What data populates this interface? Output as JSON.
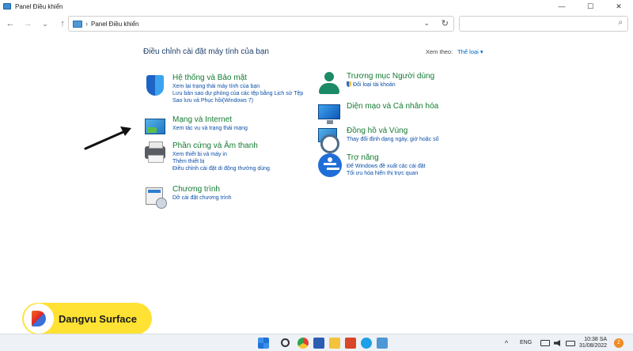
{
  "window": {
    "title": "Panel Điều khiển",
    "minimize": "—",
    "maximize": "☐",
    "close": "✕"
  },
  "nav": {
    "back": "←",
    "forward": "→",
    "dropdown": "⌄",
    "up": "↑",
    "breadcrumb_sep": "›",
    "path": "Panel Điều khiển",
    "address_dropdown": "⌄",
    "refresh": "↻",
    "search_placeholder": "",
    "search_icon": "⌕"
  },
  "header": {
    "title": "Điều chỉnh cài đặt máy tính của bạn",
    "view_by_label": "Xem theo:",
    "view_by_value": "Thể loại ▾"
  },
  "categories": [
    {
      "icon": "shield-icon",
      "title": "Hệ thống và Bảo mật",
      "links": [
        "Xem lại trạng thái máy tính của bạn",
        "Lưu bản sao dự phòng của các tệp bằng Lịch sử Tệp",
        "Sao lưu và Phục hồi(Windows 7)"
      ]
    },
    {
      "icon": "network-icon",
      "title": "Mạng và Internet",
      "links": [
        "Xem tác vụ và trạng thái mạng"
      ]
    },
    {
      "icon": "printer-icon",
      "title": "Phần cứng và Âm thanh",
      "links": [
        "Xem thiết bị và máy in",
        "Thêm thiết bị",
        "Điều chỉnh cài đặt di động thường dùng"
      ]
    },
    {
      "icon": "programs-icon",
      "title": "Chương trình",
      "links": [
        "Dỡ cài đặt chương trình"
      ]
    },
    {
      "icon": "user-accounts-icon",
      "title": "Trương mục Người dùng",
      "links": [
        "Đổi loại tài khoản"
      ]
    },
    {
      "icon": "appearance-icon",
      "title": "Diện mạo và Cá nhân hóa",
      "links": []
    },
    {
      "icon": "clock-region-icon",
      "title": "Đồng hồ và Vùng",
      "links": [
        "Thay đổi định dạng ngày, giờ hoặc số"
      ]
    },
    {
      "icon": "accessibility-icon",
      "title": "Trợ năng",
      "links": [
        "Để Windows đề xuất các cài đặt",
        "Tối ưu hóa hiển thị trực quan"
      ]
    }
  ],
  "brand": {
    "name": "Dangvu Surface"
  },
  "taskbar": {
    "language": "ENG",
    "time": "10:38 SA",
    "date": "31/08/2022",
    "notifications": "2",
    "colors": {
      "background": "#eef1f5",
      "accent": "#1f6ed8"
    }
  }
}
